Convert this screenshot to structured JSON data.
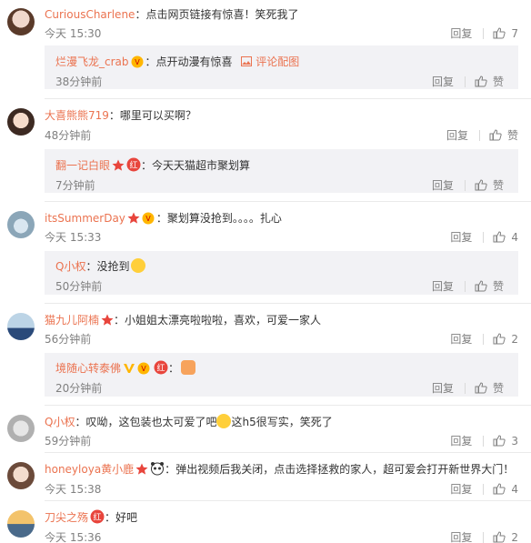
{
  "actions": {
    "reply_label": "回复",
    "like_label": "赞"
  },
  "comments": [
    {
      "user": "CuriousCharlene",
      "colon": "：",
      "text": "点击网页链接有惊喜！笑死我了",
      "time": "今天 15:30",
      "likes": "7",
      "reply": {
        "user": "烂漫飞龙_crab",
        "colon": "：",
        "text": "点开动漫有惊喜",
        "link": "评论配图",
        "time": "38分钟前"
      }
    },
    {
      "user": "大喜熊熊719",
      "colon": "：",
      "text": "哪里可以买啊？",
      "time": "48分钟前",
      "likes": "赞",
      "reply": {
        "user": "翻一记白眼",
        "colon": "：",
        "text": "今天天猫超市聚划算",
        "time": "7分钟前"
      }
    },
    {
      "user": "itsSummerDay",
      "colon": "：",
      "text": "聚划算没抢到。。。。扎心",
      "time": "今天 15:33",
      "likes": "4",
      "reply": {
        "user": "Q小权",
        "colon": "：",
        "text": "没抢到",
        "time": "50分钟前"
      }
    },
    {
      "user": "猫九儿阿楠",
      "colon": "：",
      "text": "小姐姐太漂亮啦啦啦，喜欢，可爱一家人",
      "time": "56分钟前",
      "likes": "2",
      "reply": {
        "user": "境随心转泰佛",
        "colon": "：",
        "text": "",
        "time": "20分钟前"
      }
    },
    {
      "user": "Q小权",
      "colon": "：",
      "text": "叹呦，这包装也太可爱了吧",
      "text2": "这h5很写实，笑死了",
      "time": "59分钟前",
      "likes": "3"
    },
    {
      "user": "honeyloya黄小鹿",
      "colon": "：",
      "text": "弹出视频后我关闭，点击选择拯救的家人，超可爱会打开新世界大门！",
      "time": "今天 15:38",
      "likes": "4"
    },
    {
      "user": "刀尖之殇",
      "colon": "：",
      "text": "好吧",
      "time": "今天 15:36",
      "likes": "2"
    }
  ],
  "colors": {
    "username": "#eb7350",
    "meta": "#808080",
    "reply_bg": "#f2f2f5",
    "badge_red": "#e8453c",
    "badge_orange": "#ff8200"
  },
  "icons": {
    "like": "thumbs-up-icon",
    "member": "star-badge-icon",
    "red": "red-badge-icon",
    "vip": "vip-badge-icon",
    "image": "image-icon"
  }
}
